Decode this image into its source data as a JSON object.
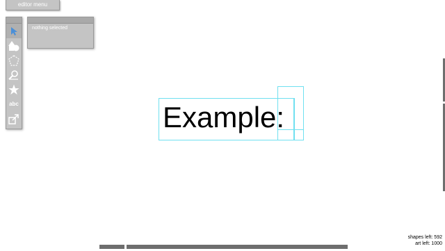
{
  "menu": {
    "label": "editor menu"
  },
  "toolbar": {
    "tools": [
      {
        "name": "select",
        "icon": "pointer-arrow-icon",
        "selected": true
      },
      {
        "name": "shapes",
        "icon": "shapes-icon"
      },
      {
        "name": "polygon",
        "icon": "polygon-icon"
      },
      {
        "name": "magnify",
        "icon": "magnify-icon"
      },
      {
        "name": "star",
        "icon": "star-icon"
      },
      {
        "name": "text",
        "label": "abc"
      },
      {
        "name": "export",
        "icon": "export-icon"
      }
    ]
  },
  "selection_panel": {
    "status": "nothing selected"
  },
  "canvas": {
    "text": "Example:"
  },
  "stats": {
    "shapes_left": "shapes left: 592",
    "art_left": "art left: 1000"
  },
  "colors": {
    "panel": "#c4c4c4",
    "selection_box": "#6fe0f0",
    "accent": "#4a8fd8"
  }
}
